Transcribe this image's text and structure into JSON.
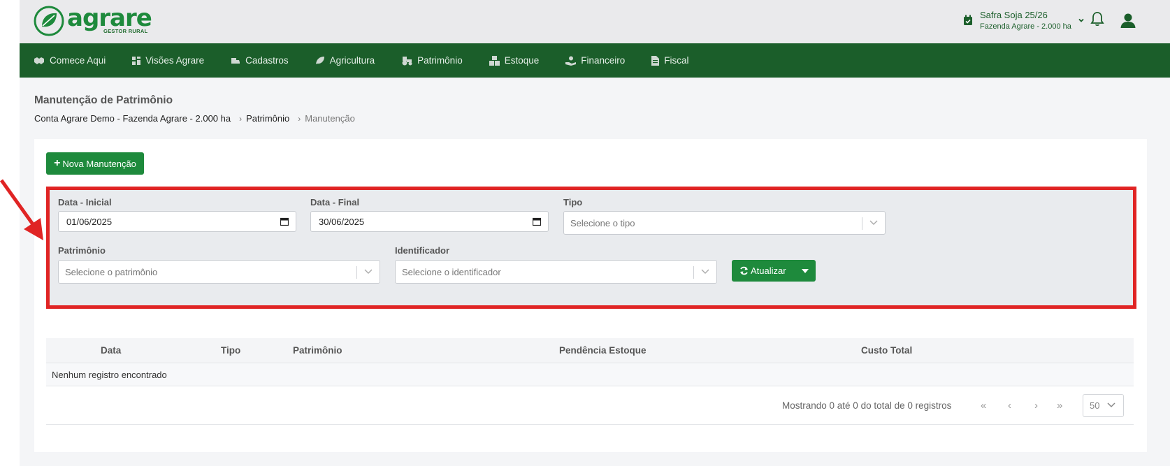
{
  "header": {
    "logo_word": "agrare",
    "logo_sub": "GESTOR RURAL",
    "safra_title": "Safra Soja 25/26",
    "safra_sub": "Fazenda Agrare - 2.000 ha"
  },
  "nav": {
    "items": [
      {
        "label": "Comece Aqui",
        "icon": "handshake-icon"
      },
      {
        "label": "Visões Agrare",
        "icon": "dashboard-icon"
      },
      {
        "label": "Cadastros",
        "icon": "truck-icon"
      },
      {
        "label": "Agricultura",
        "icon": "leaf-icon"
      },
      {
        "label": "Patrimônio",
        "icon": "tractor-icon"
      },
      {
        "label": "Estoque",
        "icon": "boxes-icon"
      },
      {
        "label": "Financeiro",
        "icon": "hand-coin-icon"
      },
      {
        "label": "Fiscal",
        "icon": "document-icon"
      }
    ]
  },
  "page": {
    "title": "Manutenção de Patrimônio",
    "breadcrumb": [
      "Conta Agrare Demo - Fazenda Agrare - 2.000 ha",
      "Patrimônio",
      "Manutenção"
    ]
  },
  "actions": {
    "new_label": "Nova Manutenção"
  },
  "filters": {
    "data_inicial_label": "Data - Inicial",
    "data_inicial_value": "01/06/2025",
    "data_final_label": "Data - Final",
    "data_final_value": "30/06/2025",
    "tipo_label": "Tipo",
    "tipo_placeholder": "Selecione o tipo",
    "patrimonio_label": "Patrimônio",
    "patrimonio_placeholder": "Selecione o patrimônio",
    "identificador_label": "Identificador",
    "identificador_placeholder": "Selecione o identificador",
    "refresh_label": "Atualizar"
  },
  "table": {
    "columns": [
      "Data",
      "Tipo",
      "Patrimônio",
      "Pendência Estoque",
      "Custo Total"
    ],
    "empty_message": "Nenhum registro encontrado",
    "pager_text": "Mostrando 0 até 0 do total de 0 registros",
    "page_size": "50"
  },
  "colors": {
    "brand_green": "#1e8a3c",
    "nav_green": "#1b5e2a",
    "highlight_red": "#e02424"
  }
}
